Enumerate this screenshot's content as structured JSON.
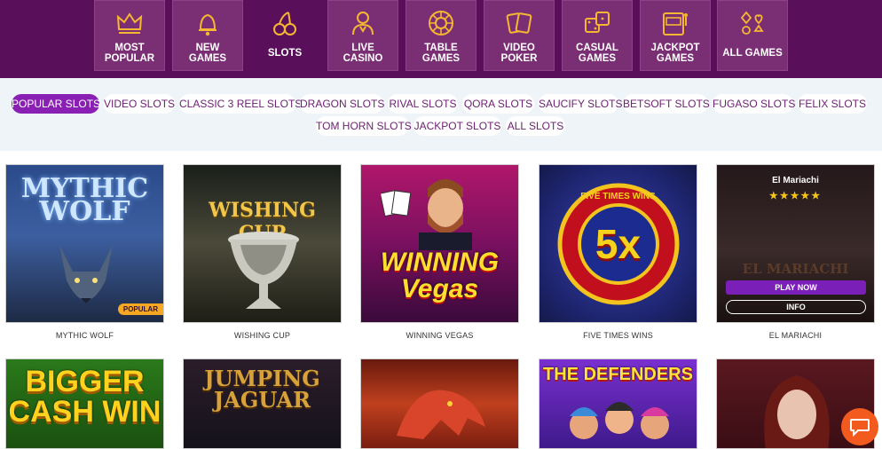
{
  "categories": [
    {
      "label": "MOST\nPOPULAR",
      "icon": "crown-icon"
    },
    {
      "label": "NEW\nGAMES",
      "icon": "bell-icon"
    },
    {
      "label": "SLOTS",
      "icon": "cherries-icon"
    },
    {
      "label": "LIVE\nCASINO",
      "icon": "dealer-icon"
    },
    {
      "label": "TABLE\nGAMES",
      "icon": "roulette-icon"
    },
    {
      "label": "VIDEO\nPOKER",
      "icon": "cards-icon"
    },
    {
      "label": "CASUAL\nGAMES",
      "icon": "dice-icon"
    },
    {
      "label": "JACKPOT\nGAMES",
      "icon": "slot-machine-icon"
    },
    {
      "label": "ALL GAMES",
      "icon": "card-suits-icon"
    }
  ],
  "active_category": "SLOTS",
  "filters": [
    "POPULAR SLOTS",
    "VIDEO SLOTS",
    "CLASSIC 3 REEL SLOTS",
    "DRAGON SLOTS",
    "RIVAL SLOTS",
    "QORA SLOTS",
    "SAUCIFY SLOTS",
    "BETSOFT SLOTS",
    "FUGASO SLOTS",
    "FELIX SLOTS",
    "TOM HORN SLOTS",
    "JACKPOT SLOTS",
    "ALL SLOTS"
  ],
  "active_filter": "POPULAR SLOTS",
  "games": [
    {
      "name": "MYTHIC WOLF",
      "art": "MYTHIC\nWOLF",
      "badge": "POPULAR"
    },
    {
      "name": "WISHING CUP",
      "art": "WISHING CUP"
    },
    {
      "name": "WINNING VEGAS",
      "art": "WINNING\nVegas"
    },
    {
      "name": "FIVE TIMES WINS",
      "art": "5x",
      "ring": "FIVE TIMES WINS"
    },
    {
      "name": "EL MARIACHI",
      "hover_title": "El Mariachi",
      "stars": 5,
      "play_label": "PLAY NOW",
      "info_label": "INFO",
      "art": "EL MARIACHI"
    }
  ],
  "games_row2": [
    {
      "art": "BIGGER\nCASH WIN"
    },
    {
      "art": "JUMPING\nJAGUAR"
    },
    {
      "art": ""
    },
    {
      "art": "THE DEFENDERS"
    },
    {
      "art": ""
    }
  ],
  "chat": {
    "icon": "chat-bubble-icon"
  }
}
